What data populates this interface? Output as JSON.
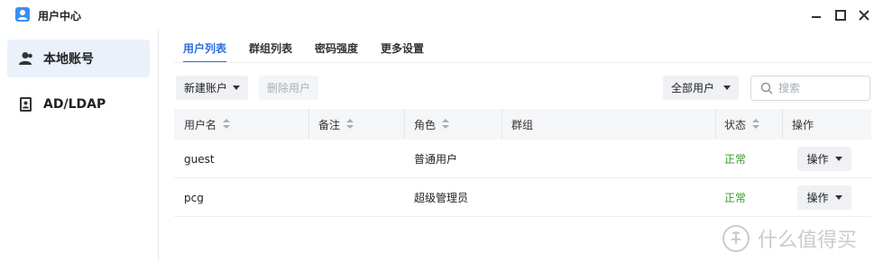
{
  "window": {
    "title": "用户中心",
    "icons": {
      "app": "user-center-icon",
      "minimize": "minimize-icon",
      "maximize": "maximize-icon",
      "close": "close-icon"
    }
  },
  "sidebar": {
    "items": [
      {
        "label": "本地账号",
        "icon": "local-user-icon",
        "active": true
      },
      {
        "label": "AD/LDAP",
        "icon": "directory-book-icon",
        "active": false
      }
    ]
  },
  "tabs": [
    {
      "label": "用户列表",
      "active": true
    },
    {
      "label": "群组列表",
      "active": false
    },
    {
      "label": "密码强度",
      "active": false
    },
    {
      "label": "更多设置",
      "active": false
    }
  ],
  "toolbar": {
    "new_account": "新建账户",
    "delete_user": "删除用户",
    "filter_value": "全部用户",
    "search_placeholder": "搜索"
  },
  "table": {
    "headers": {
      "username": "用户名",
      "note": "备注",
      "role": "角色",
      "group": "群组",
      "status": "状态",
      "action": "操作"
    },
    "rows": [
      {
        "username": "guest",
        "note": "",
        "role": "普通用户",
        "group": "",
        "status": "正常",
        "action": "操作"
      },
      {
        "username": "pcg",
        "note": "",
        "role": "超级管理员",
        "group": "",
        "status": "正常",
        "action": "操作"
      }
    ]
  },
  "colors": {
    "accent": "#2e6fdc",
    "status_ok": "#3c9a2e"
  },
  "watermark": {
    "text": "什么值得买"
  }
}
